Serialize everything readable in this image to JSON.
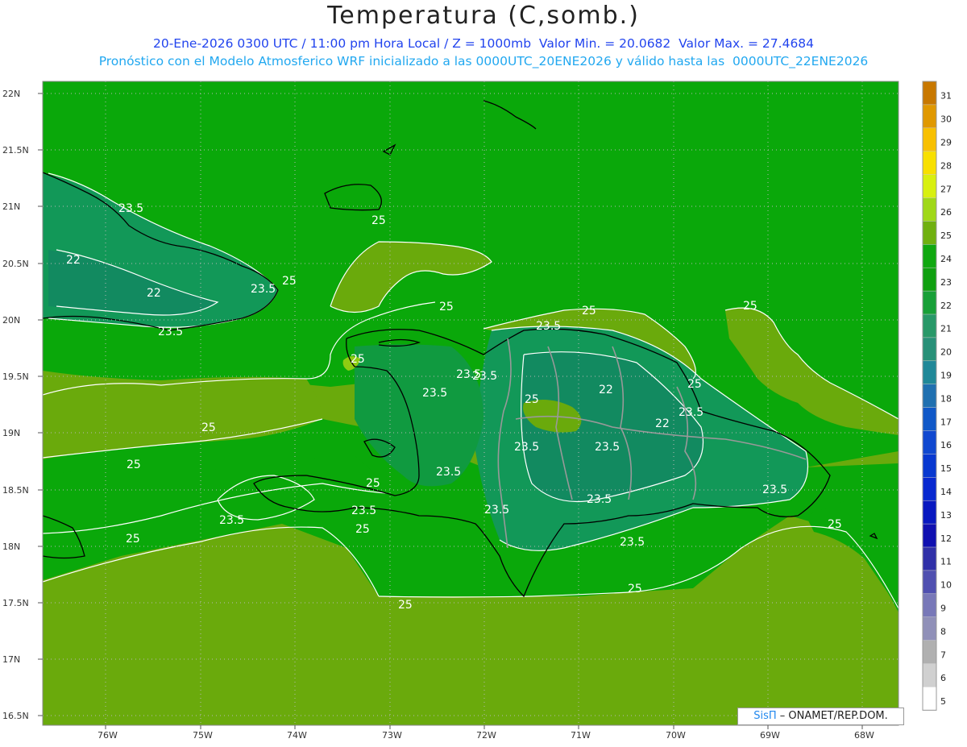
{
  "header": {
    "title": "Temperatura (C,somb.)",
    "line1": "20-Ene-2026 0300 UTC / 11:00 pm Hora Local / Z = 1000mb  Valor Min. = 20.0682  Valor Max. = 27.4684",
    "line2": "Pronóstico con el Modelo Atmosferico WRF inicializado a las 0000UTC_20ENE2026 y válido hasta las  0000UTC_22ENE2026"
  },
  "map": {
    "lat_labels": [
      "22N",
      "21.5N",
      "21N",
      "20.5N",
      "20N",
      "19.5N",
      "19N",
      "18.5N",
      "18N",
      "17.5N",
      "17N",
      "16.5N"
    ],
    "lon_labels": [
      "76W",
      "75W",
      "74W",
      "73W",
      "72W",
      "71W",
      "70W",
      "69W",
      "68W"
    ],
    "contour_labels": [
      {
        "text": "23.5"
      },
      {
        "text": "22"
      },
      {
        "text": "22"
      },
      {
        "text": "23.5"
      },
      {
        "text": "23.5"
      },
      {
        "text": "25"
      },
      {
        "text": "25"
      },
      {
        "text": "25"
      },
      {
        "text": "25"
      },
      {
        "text": "25"
      },
      {
        "text": "23.5"
      },
      {
        "text": "25"
      },
      {
        "text": "23.5"
      },
      {
        "text": "22"
      },
      {
        "text": "22"
      },
      {
        "text": "25"
      },
      {
        "text": "23.5"
      },
      {
        "text": "25"
      },
      {
        "text": "25"
      },
      {
        "text": "23.5"
      },
      {
        "text": "23.5"
      },
      {
        "text": "23.5"
      },
      {
        "text": "25"
      },
      {
        "text": "23.5"
      },
      {
        "text": "23.5"
      },
      {
        "text": "23.5"
      },
      {
        "text": "25"
      },
      {
        "text": "23.5"
      },
      {
        "text": "25"
      },
      {
        "text": "25"
      },
      {
        "text": "23.5"
      },
      {
        "text": "23.5"
      },
      {
        "text": "23.5"
      },
      {
        "text": "25"
      },
      {
        "text": "25"
      },
      {
        "text": "25"
      },
      {
        "text": "23.5"
      }
    ],
    "colors": {
      "warm_25": "#6aaa0c",
      "mid_24": "#0aa80a",
      "cool_22": "#12a030",
      "cool_21": "#129858",
      "cool_20": "#128a60",
      "yellowgreen_26": "#8fcc12"
    }
  },
  "colorbar": {
    "labels": [
      "31",
      "30",
      "29",
      "28",
      "27",
      "26",
      "25",
      "24",
      "23",
      "22",
      "21",
      "20",
      "19",
      "18",
      "17",
      "16",
      "15",
      "14",
      "13",
      "12",
      "11",
      "10",
      "9",
      "8",
      "7",
      "6",
      "5"
    ],
    "colors": [
      "#c87800",
      "#e09800",
      "#f8c000",
      "#f8e000",
      "#d8f010",
      "#a0d818",
      "#70b010",
      "#10a810",
      "#10a010",
      "#18a038",
      "#289868",
      "#289078",
      "#208898",
      "#2070b0",
      "#1058c8",
      "#1048d0",
      "#0838d0",
      "#0828d0",
      "#0818c0",
      "#1010b0",
      "#3030a8",
      "#5050b0",
      "#7878b8",
      "#9090b8",
      "#b0b0b0",
      "#d0d0d0",
      "#ffffff"
    ]
  },
  "credit": {
    "brand": "SisΠ",
    "text": " – ONAMET/REP.DOM."
  }
}
